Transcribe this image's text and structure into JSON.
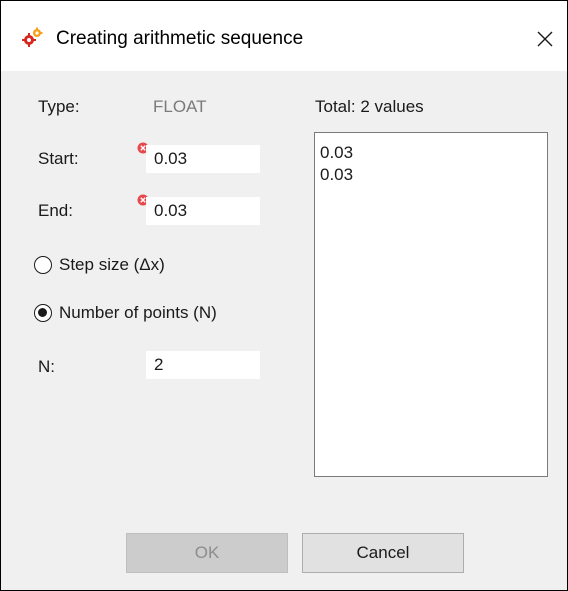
{
  "window": {
    "title": "Creating arithmetic sequence",
    "icon": "gear-cluster-icon",
    "close_icon": "close-icon"
  },
  "form": {
    "type_label": "Type:",
    "type_value": "FLOAT",
    "start_label": "Start:",
    "start_value": "0.03",
    "end_label": "End:",
    "end_value": "0.03",
    "step_size_label": "Step size (Δx)",
    "step_size_selected": false,
    "num_points_label": "Number of points (N)",
    "num_points_selected": true,
    "n_label": "N:",
    "n_value": "2"
  },
  "values_panel": {
    "total_label": "Total: 2 values",
    "items": [
      "0.03",
      "0.03"
    ]
  },
  "buttons": {
    "ok_label": "OK",
    "ok_enabled": false,
    "cancel_label": "Cancel"
  },
  "colors": {
    "error_badge": "#e5484d",
    "icon_red": "#d7261e",
    "icon_orange": "#f6a21a"
  }
}
